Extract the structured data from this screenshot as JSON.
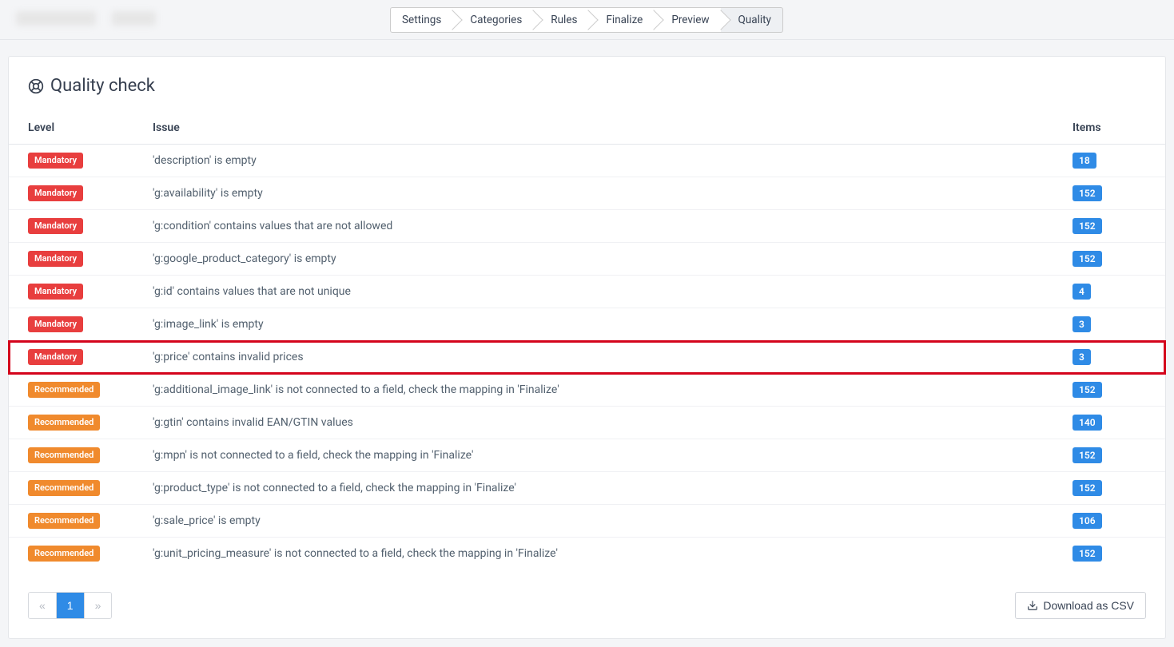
{
  "steps": [
    {
      "label": "Settings",
      "active": false
    },
    {
      "label": "Categories",
      "active": false
    },
    {
      "label": "Rules",
      "active": false
    },
    {
      "label": "Finalize",
      "active": false
    },
    {
      "label": "Preview",
      "active": false
    },
    {
      "label": "Quality",
      "active": true
    }
  ],
  "panel_title": "Quality check",
  "columns": {
    "level": "Level",
    "issue": "Issue",
    "items": "Items"
  },
  "level_labels": {
    "mandatory": "Mandatory",
    "recommended": "Recommended"
  },
  "rows": [
    {
      "level": "mandatory",
      "issue": "'description' is empty",
      "items": "18",
      "highlight": false
    },
    {
      "level": "mandatory",
      "issue": "'g:availability' is empty",
      "items": "152",
      "highlight": false
    },
    {
      "level": "mandatory",
      "issue": "'g:condition' contains values that are not allowed",
      "items": "152",
      "highlight": false
    },
    {
      "level": "mandatory",
      "issue": "'g:google_product_category' is empty",
      "items": "152",
      "highlight": false
    },
    {
      "level": "mandatory",
      "issue": "'g:id' contains values that are not unique",
      "items": "4",
      "highlight": false
    },
    {
      "level": "mandatory",
      "issue": "'g:image_link' is empty",
      "items": "3",
      "highlight": false
    },
    {
      "level": "mandatory",
      "issue": "'g:price' contains invalid prices",
      "items": "3",
      "highlight": true
    },
    {
      "level": "recommended",
      "issue": "'g:additional_image_link' is not connected to a field, check the mapping in 'Finalize'",
      "items": "152",
      "highlight": false
    },
    {
      "level": "recommended",
      "issue": "'g:gtin' contains invalid EAN/GTIN values",
      "items": "140",
      "highlight": false
    },
    {
      "level": "recommended",
      "issue": "'g:mpn' is not connected to a field, check the mapping in 'Finalize'",
      "items": "152",
      "highlight": false
    },
    {
      "level": "recommended",
      "issue": "'g:product_type' is not connected to a field, check the mapping in 'Finalize'",
      "items": "152",
      "highlight": false
    },
    {
      "level": "recommended",
      "issue": "'g:sale_price' is empty",
      "items": "106",
      "highlight": false
    },
    {
      "level": "recommended",
      "issue": "'g:unit_pricing_measure' is not connected to a field, check the mapping in 'Finalize'",
      "items": "152",
      "highlight": false
    }
  ],
  "pagination": {
    "prev": "«",
    "next": "»",
    "pages": [
      "1"
    ],
    "current": "1"
  },
  "download_label": "Download as CSV"
}
